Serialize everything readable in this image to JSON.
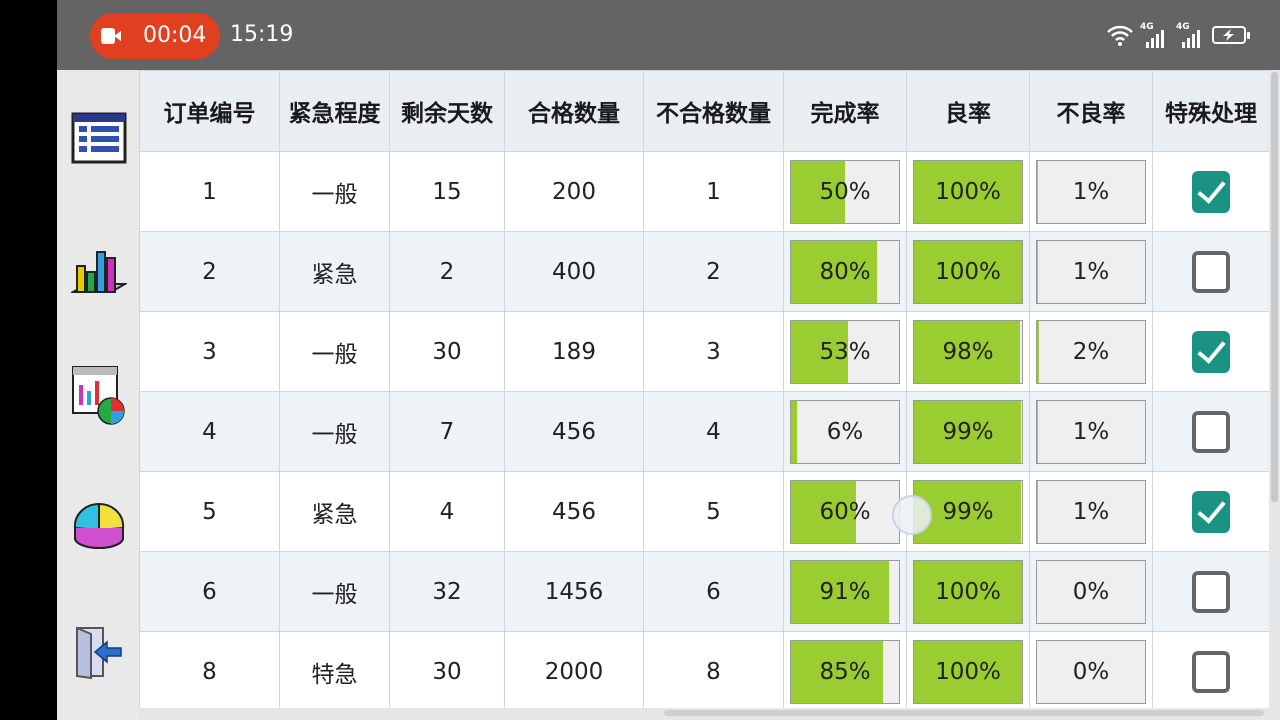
{
  "status_bar": {
    "recording_time": "00:04",
    "clock": "15:19",
    "signal_labels": [
      "4G",
      "4G"
    ],
    "icons": [
      "record-icon",
      "wifi-icon",
      "signal-icon",
      "battery-charging-icon"
    ],
    "record_color": "#e0401f"
  },
  "sidebar": {
    "icons": [
      "table-view-icon",
      "bar-chart-icon",
      "chart-report-icon",
      "pie-chart-icon",
      "exit-icon"
    ]
  },
  "table": {
    "headers": [
      "订单编号",
      "紧急程度",
      "剩余天数",
      "合格数量",
      "不合格数量",
      "完成率",
      "良率",
      "不良率",
      "特殊处理"
    ],
    "rows": [
      {
        "id": "1",
        "urgency": "一般",
        "days_left": "15",
        "qualified": "200",
        "unqualified": "1",
        "completion": "50%",
        "completion_value": 0.5,
        "yield": "100%",
        "yield_value": 1.0,
        "defect": "1%",
        "defect_value": 0.01,
        "special": true
      },
      {
        "id": "2",
        "urgency": "紧急",
        "days_left": "2",
        "qualified": "400",
        "unqualified": "2",
        "completion": "80%",
        "completion_value": 0.8,
        "yield": "100%",
        "yield_value": 1.0,
        "defect": "1%",
        "defect_value": 0.01,
        "special": false
      },
      {
        "id": "3",
        "urgency": "一般",
        "days_left": "30",
        "qualified": "189",
        "unqualified": "3",
        "completion": "53%",
        "completion_value": 0.53,
        "yield": "98%",
        "yield_value": 0.98,
        "defect": "2%",
        "defect_value": 0.02,
        "special": true
      },
      {
        "id": "4",
        "urgency": "一般",
        "days_left": "7",
        "qualified": "456",
        "unqualified": "4",
        "completion": "6%",
        "completion_value": 0.06,
        "yield": "99%",
        "yield_value": 0.99,
        "defect": "1%",
        "defect_value": 0.01,
        "special": false
      },
      {
        "id": "5",
        "urgency": "紧急",
        "days_left": "4",
        "qualified": "456",
        "unqualified": "5",
        "completion": "60%",
        "completion_value": 0.6,
        "yield": "99%",
        "yield_value": 0.99,
        "defect": "1%",
        "defect_value": 0.01,
        "special": true
      },
      {
        "id": "6",
        "urgency": "一般",
        "days_left": "32",
        "qualified": "1456",
        "unqualified": "6",
        "completion": "91%",
        "completion_value": 0.91,
        "yield": "100%",
        "yield_value": 1.0,
        "defect": "0%",
        "defect_value": 0.0,
        "special": false
      },
      {
        "id": "8",
        "urgency": "特急",
        "days_left": "30",
        "qualified": "2000",
        "unqualified": "8",
        "completion": "85%",
        "completion_value": 0.85,
        "yield": "100%",
        "yield_value": 1.0,
        "defect": "0%",
        "defect_value": 0.0,
        "special": false
      }
    ],
    "bar_fill_color": "#9acd32",
    "checkbox_color": "#1a9384"
  }
}
